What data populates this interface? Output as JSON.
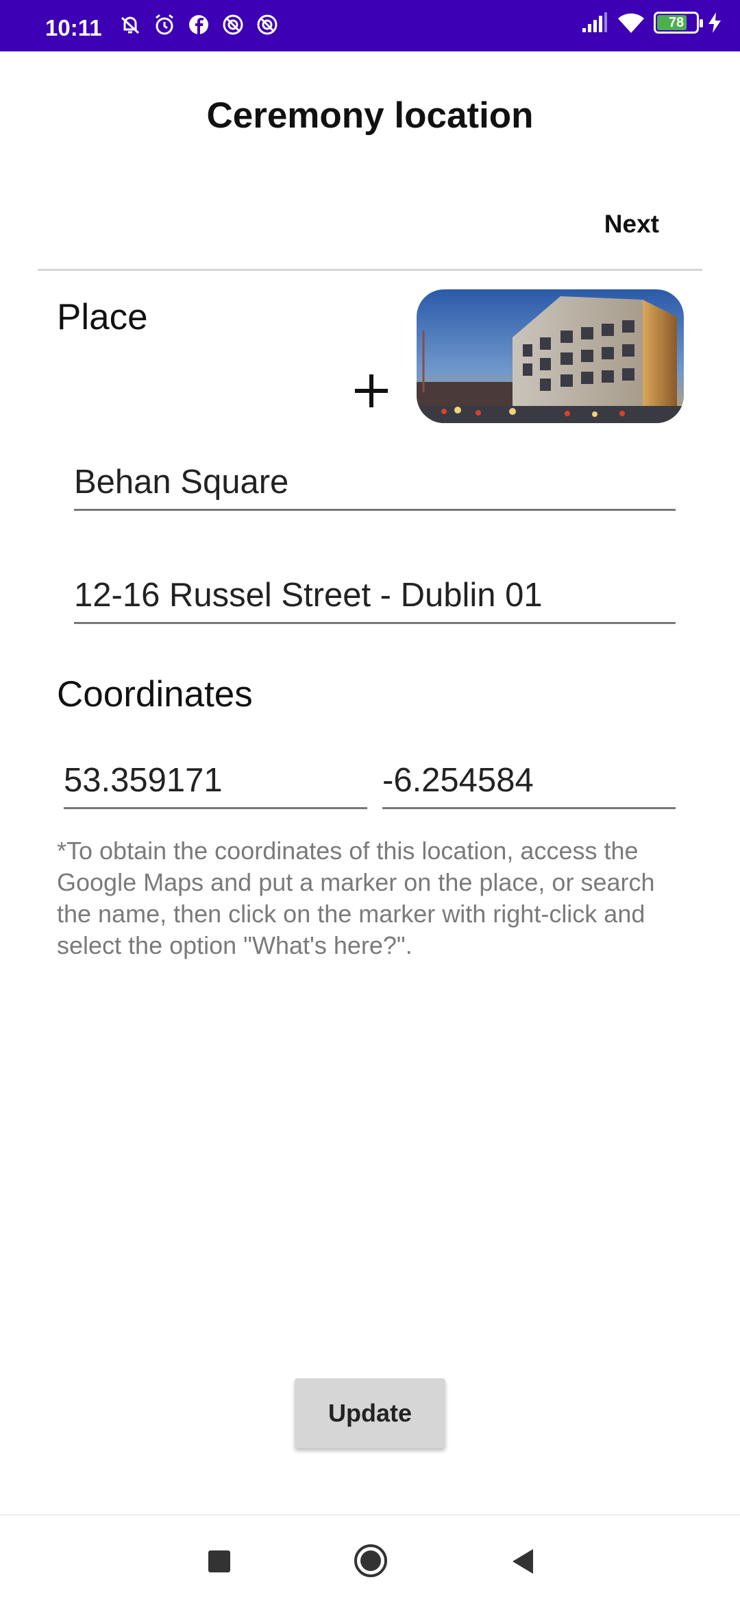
{
  "status_bar": {
    "time": "10:11",
    "battery": "78",
    "battery_level": 0.78
  },
  "header": {
    "title": "Ceremony location",
    "next_label": "Next"
  },
  "place": {
    "label": "Place",
    "name_value": "Behan Square",
    "address_value": "12-16 Russel Street - Dublin 01"
  },
  "coordinates": {
    "label": "Coordinates",
    "latitude": "53.359171",
    "longitude": "-6.254584",
    "hint": "*To obtain the coordinates of this location, access the Google Maps and put a marker on the place, or search the name, then click on the marker with right-click and select the option \"What's here?\"."
  },
  "actions": {
    "update_label": "Update"
  },
  "colors": {
    "status_bar": "#3d00b4",
    "battery_fill": "#4caf50",
    "button_bg": "#d6d6d6"
  },
  "icons": [
    "mute-bell-icon",
    "alarm-icon",
    "facebook-icon",
    "app-notification-icon",
    "signal-icon",
    "wifi-icon",
    "battery-icon",
    "charging-icon",
    "plus-icon",
    "recents-icon",
    "home-icon",
    "back-icon"
  ]
}
